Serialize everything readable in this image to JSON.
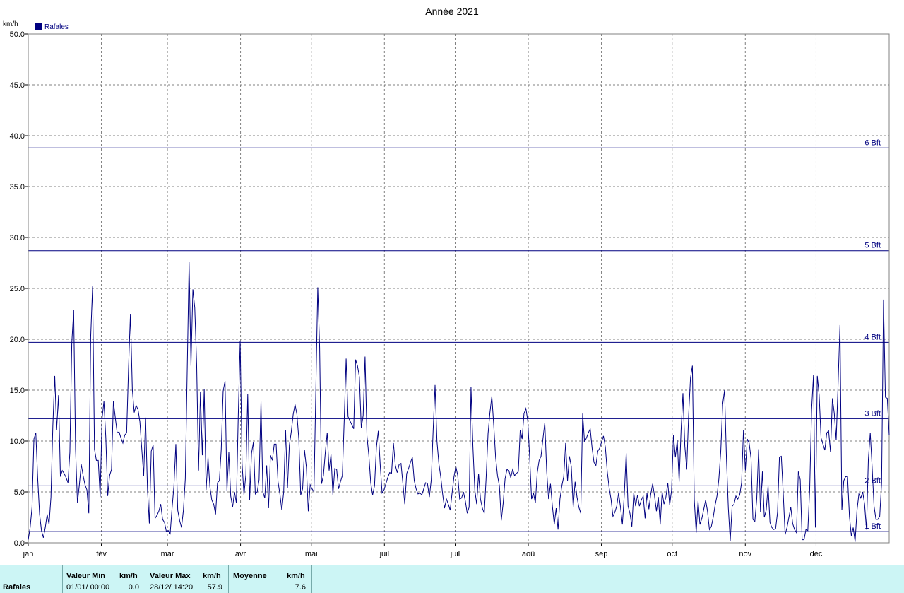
{
  "chart_data": {
    "type": "line",
    "title": "Année 2021",
    "ylabel": "km/h",
    "ylim": [
      0,
      50
    ],
    "yticks": [
      "0.0",
      "5.0",
      "10.0",
      "15.0",
      "20.0",
      "25.0",
      "30.0",
      "35.0",
      "40.0",
      "45.0",
      "50.0"
    ],
    "xlabels": [
      "jan",
      "fév",
      "mar",
      "avr",
      "mai",
      "juil",
      "juil",
      "aoû",
      "sep",
      "oct",
      "nov",
      "déc"
    ],
    "grid": true,
    "legend_position": "top-left",
    "line_color": "#000080",
    "series": [
      {
        "name": "Rafales",
        "values": [
          0.3,
          1.5,
          3.5,
          10.2,
          10.8,
          6.3,
          2.8,
          1.2,
          0.5,
          1.5,
          2.8,
          1.8,
          4.5,
          11.5,
          16.4,
          11.1,
          14.5,
          6.5,
          7.1,
          6.8,
          6.4,
          5.9,
          8.9,
          19.6,
          22.9,
          9.2,
          3.9,
          5.7,
          7.7,
          6.6,
          5.7,
          5.2,
          2.9,
          20.2,
          25.2,
          9.2,
          8.1,
          8.1,
          4.5,
          12.2,
          13.9,
          10.3,
          4.6,
          6.6,
          7.2,
          13.9,
          12.3,
          10.8,
          10.9,
          10.3,
          9.8,
          10.6,
          10.8,
          17.2,
          22.5,
          15.1,
          12.8,
          13.5,
          13.1,
          11.9,
          9.2,
          6.6,
          12.3,
          5.3,
          1.9,
          9.0,
          9.6,
          2.4,
          2.7,
          3.1,
          3.8,
          2.3,
          2.0,
          1.1,
          1.2,
          0.9,
          3.4,
          5.6,
          9.7,
          3.2,
          2.2,
          1.5,
          3.2,
          6.3,
          16.9,
          27.6,
          17.4,
          24.9,
          23.1,
          17.5,
          7.1,
          14.8,
          8.6,
          15.1,
          5.2,
          8.4,
          5.5,
          4.2,
          3.8,
          2.8,
          5.9,
          6.1,
          9.2,
          14.9,
          15.9,
          5.1,
          8.9,
          4.6,
          3.5,
          5.0,
          3.9,
          12.6,
          19.8,
          7.8,
          4.7,
          6.7,
          14.6,
          4.2,
          8.8,
          9.9,
          4.8,
          5.0,
          6.2,
          13.9,
          5.0,
          4.4,
          7.6,
          3.4,
          8.6,
          8.1,
          9.7,
          9.7,
          6.0,
          4.8,
          3.2,
          5.0,
          11.1,
          5.4,
          9.6,
          10.9,
          12.6,
          13.6,
          12.6,
          10.2,
          4.7,
          5.3,
          9.1,
          7.4,
          3.1,
          5.7,
          5.3,
          5.0,
          15.2,
          25.1,
          19.2,
          5.8,
          6.6,
          8.9,
          10.8,
          7.1,
          8.7,
          4.7,
          7.3,
          7.2,
          5.3,
          6.0,
          6.6,
          12.1,
          18.1,
          12.4,
          12.0,
          11.6,
          11.2,
          18.0,
          17.4,
          16.3,
          11.3,
          12.5,
          18.3,
          10.5,
          8.6,
          5.9,
          4.7,
          5.6,
          9.4,
          11.0,
          7.7,
          4.9,
          5.2,
          5.8,
          6.4,
          6.9,
          6.8,
          9.8,
          7.6,
          6.9,
          7.7,
          7.8,
          5.8,
          3.8,
          6.8,
          7.3,
          7.9,
          8.4,
          6.1,
          5.3,
          4.8,
          4.9,
          4.7,
          5.3,
          5.9,
          5.8,
          4.5,
          6.2,
          11.1,
          15.5,
          10.0,
          7.8,
          6.5,
          4.8,
          3.4,
          4.3,
          3.8,
          3.2,
          4.9,
          6.5,
          7.5,
          6.6,
          4.3,
          4.4,
          5.0,
          4.1,
          2.9,
          3.5,
          15.3,
          9.5,
          5.2,
          3.8,
          6.8,
          4.3,
          3.4,
          2.9,
          6.4,
          10.7,
          12.8,
          14.4,
          11.6,
          8.4,
          6.6,
          5.6,
          2.2,
          3.9,
          6.3,
          7.2,
          7.1,
          6.4,
          7.2,
          6.6,
          6.8,
          7.0,
          11.1,
          10.2,
          12.7,
          13.2,
          12.0,
          8.4,
          4.3,
          4.9,
          3.9,
          6.9,
          8.1,
          8.5,
          10.2,
          11.8,
          7.0,
          4.3,
          5.8,
          3.6,
          1.8,
          3.4,
          1.3,
          4.3,
          5.6,
          6.5,
          9.8,
          6.1,
          8.5,
          7.5,
          3.5,
          6.0,
          4.5,
          3.5,
          2.9,
          12.7,
          9.9,
          10.3,
          10.8,
          11.2,
          9.3,
          7.9,
          7.6,
          9.0,
          9.3,
          9.9,
          10.5,
          9.4,
          7.0,
          5.4,
          4.3,
          2.6,
          3.0,
          3.6,
          4.9,
          3.5,
          1.8,
          4.7,
          8.8,
          3.6,
          2.9,
          1.6,
          4.9,
          3.6,
          4.7,
          3.6,
          4.2,
          4.6,
          2.4,
          4.9,
          3.3,
          4.8,
          5.8,
          4.6,
          3.1,
          4.5,
          1.8,
          5.0,
          3.8,
          4.5,
          5.9,
          3.7,
          5.2,
          10.6,
          8.4,
          10.1,
          6.0,
          11.0,
          14.7,
          9.5,
          7.2,
          12.5,
          16.2,
          17.4,
          4.2,
          1.0,
          4.1,
          1.8,
          2.4,
          3.3,
          4.2,
          3.1,
          1.3,
          1.6,
          2.5,
          3.7,
          4.6,
          6.3,
          9.0,
          13.6,
          15.0,
          8.3,
          3.4,
          0.2,
          3.6,
          3.8,
          4.6,
          4.3,
          4.7,
          5.9,
          11.1,
          7.1,
          10.2,
          9.8,
          8.3,
          2.3,
          2.1,
          4.3,
          9.2,
          3.0,
          7.0,
          2.5,
          3.2,
          5.6,
          2.0,
          1.5,
          1.3,
          1.4,
          3.0,
          8.4,
          8.5,
          4.9,
          0.8,
          1.5,
          2.5,
          3.5,
          1.9,
          1.3,
          1.0,
          7.0,
          6.2,
          0.3,
          0.3,
          1.3,
          1.2,
          5.3,
          13.1,
          16.5,
          1.5,
          16.4,
          14.5,
          10.3,
          9.7,
          9.1,
          10.8,
          11.0,
          8.9,
          14.2,
          12.7,
          10.1,
          15.6,
          21.4,
          3.2,
          6.1,
          6.5,
          6.5,
          2.6,
          0.7,
          1.5,
          0.1,
          3.2,
          4.8,
          4.4,
          5.0,
          3.8,
          1.3,
          8.2,
          10.8,
          7.4,
          3.6,
          2.3,
          2.3,
          2.6,
          5.9,
          23.9,
          14.3,
          14.2,
          10.6
        ]
      }
    ],
    "beaufort_lines": [
      {
        "label": "1 Bft",
        "value": 1.1
      },
      {
        "label": "2 Bft",
        "value": 5.6
      },
      {
        "label": "3 Bft",
        "value": 12.2
      },
      {
        "label": "4 Bft",
        "value": 19.7
      },
      {
        "label": "5 Bft",
        "value": 28.7
      },
      {
        "label": "6 Bft",
        "value": 38.8
      }
    ]
  },
  "stats": {
    "series_label": "Rafales",
    "min_header": "Valeur Min",
    "min_unit": "km/h",
    "min_date": "01/01/  00:00",
    "min_value": "0.0",
    "max_header": "Valeur Max",
    "max_unit": "km/h",
    "max_date": "28/12/  14:20",
    "max_value": "57.9",
    "avg_header": "Moyenne",
    "avg_unit": "km/h",
    "avg_value": "7.6"
  }
}
